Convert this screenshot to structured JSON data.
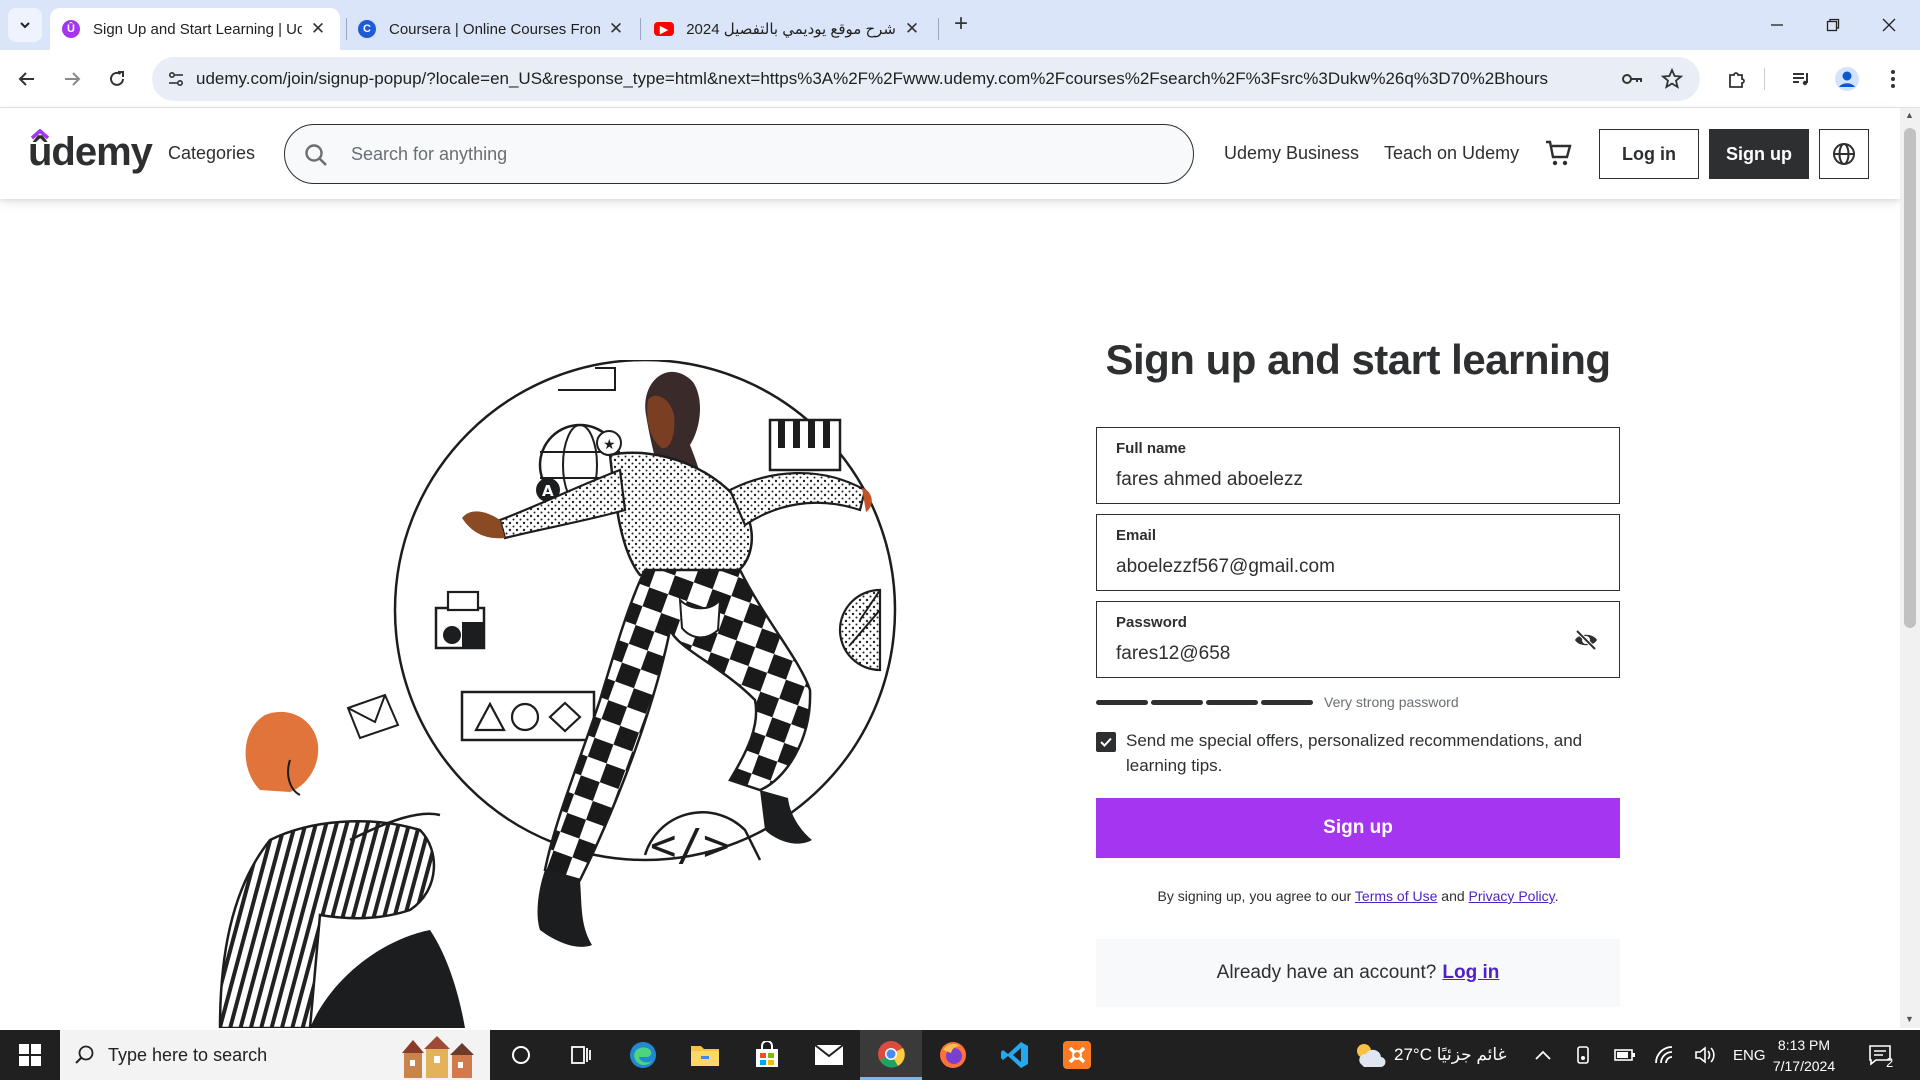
{
  "browser": {
    "tabs": [
      {
        "title": "Sign Up and Start Learning | Ud",
        "active": true,
        "favicon": "udemy-favicon"
      },
      {
        "title": "Coursera | Online Courses From",
        "active": false,
        "favicon": "coursera-favicon"
      },
      {
        "title": "شرح موقع يوديمي بالتفصيل 2024",
        "active": false,
        "favicon": "youtube-favicon"
      }
    ],
    "url": "udemy.com/join/signup-popup/?locale=en_US&response_type=html&next=https%3A%2F%2Fwww.udemy.com%2Fcourses%2Fsearch%2F%3Fsrc%3Dukw%26q%3D70%2Bhours"
  },
  "header": {
    "logo": "ûdemy",
    "categories": "Categories",
    "search_placeholder": "Search for anything",
    "udemy_business": "Udemy Business",
    "teach": "Teach on Udemy",
    "login": "Log in",
    "signup": "Sign up"
  },
  "form": {
    "title": "Sign up and start learning",
    "fullname": {
      "label": "Full name",
      "value": "fares ahmed aboelezz"
    },
    "email": {
      "label": "Email",
      "value": "aboelezzf567@gmail.com"
    },
    "password": {
      "label": "Password",
      "value": "fares12@658"
    },
    "strength_label": "Very strong password",
    "strength_level": 1.0,
    "consent_text": "Send me special offers, personalized recommendations, and learning tips.",
    "consent_checked": true,
    "submit": "Sign up",
    "legal_prefix": "By signing up, you agree to our",
    "terms": "Terms of Use",
    "and": "and",
    "privacy": "Privacy Policy",
    "legal_suffix": ".",
    "already": "Already have an account?",
    "login_link": "Log in"
  },
  "taskbar": {
    "search_placeholder": "Type here to search",
    "weather": "27°C  غائم جزئيًا",
    "lang": "ENG",
    "time": "8:13 PM",
    "date": "7/17/2024",
    "notifications": "2"
  },
  "colors": {
    "brand": "#a435f0",
    "link": "#5022c3",
    "text": "#2d2f31",
    "tabstrip": "#dbe5f9"
  }
}
